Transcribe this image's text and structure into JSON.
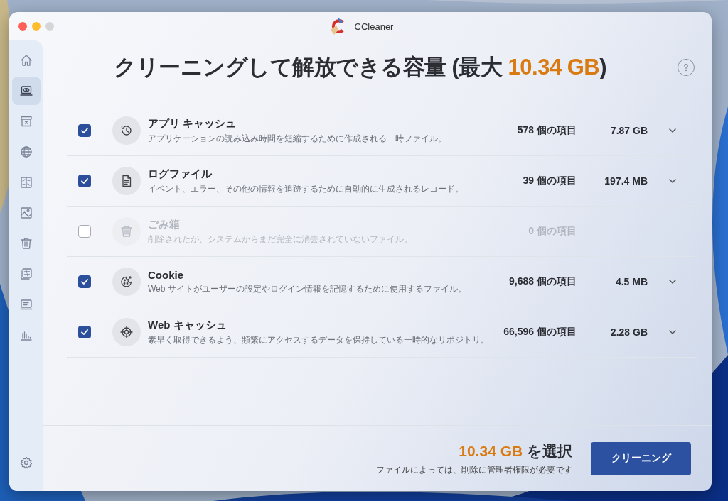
{
  "window": {
    "title": "CCleaner"
  },
  "sidebar": {
    "items": [
      {
        "selected": false
      },
      {
        "selected": true
      },
      {
        "selected": false
      },
      {
        "selected": false
      },
      {
        "selected": false
      },
      {
        "selected": false
      },
      {
        "selected": false
      },
      {
        "selected": false
      },
      {
        "selected": false
      },
      {
        "selected": false
      }
    ]
  },
  "heading": {
    "before": "クリーニングして解放できる容量 (最大 ",
    "amount": "10.34 GB",
    "after": ")"
  },
  "rows": [
    {
      "title": "アプリ キャッシュ",
      "description": "アプリケーションの読み込み時間を短縮するために作成される一時ファイル。",
      "count": "578 個の項目",
      "size": "7.87 GB",
      "checked": true,
      "disabled": false,
      "expandable": true
    },
    {
      "title": "ログファイル",
      "description": "イベント、エラー、その他の情報を追跡するために自動的に生成されるレコード。",
      "count": "39 個の項目",
      "size": "197.4 MB",
      "checked": true,
      "disabled": false,
      "expandable": true
    },
    {
      "title": "ごみ箱",
      "description": "削除されたが、システムからまだ完全に消去されていないファイル。",
      "count": "0 個の項目",
      "checked": false,
      "disabled": true,
      "expandable": false
    },
    {
      "title": "Cookie",
      "description": "Web サイトがユーザーの設定やログイン情報を記憶するために使用するファイル。",
      "count": "9,688 個の項目",
      "size": "4.5 MB",
      "checked": true,
      "disabled": false,
      "expandable": true
    },
    {
      "title": "Web キャッシュ",
      "description": "素早く取得できるよう、頻繁にアクセスするデータを保持している一時的なリポジトリ。",
      "count": "66,596 個の項目",
      "size": "2.28 GB",
      "checked": true,
      "disabled": false,
      "expandable": true
    }
  ],
  "footer": {
    "amount": "10.34 GB",
    "label": "を選択",
    "note": "ファイルによっては、削除に管理者権限が必要です",
    "button": "クリーニング"
  }
}
